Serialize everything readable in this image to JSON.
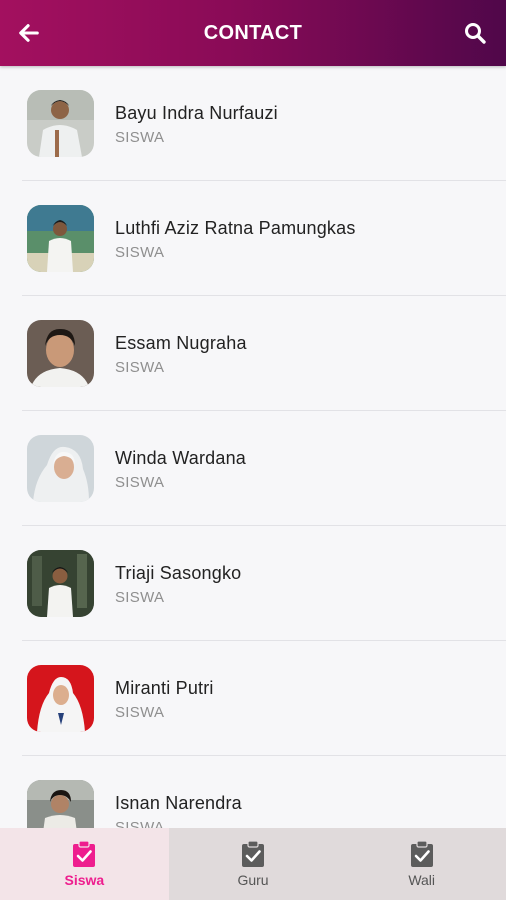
{
  "header": {
    "title": "CONTACT",
    "back_icon": "arrow-left-icon",
    "search_icon": "search-icon",
    "gradient_start": "#a3105f",
    "gradient_end": "#50074a"
  },
  "contacts": [
    {
      "name": "Bayu Indra Nurfauzi",
      "role": "SISWA",
      "avatar": "photo-avatar"
    },
    {
      "name": "Luthfi Aziz Ratna Pamungkas",
      "role": "SISWA",
      "avatar": "photo-avatar"
    },
    {
      "name": "Essam Nugraha",
      "role": "SISWA",
      "avatar": "photo-avatar"
    },
    {
      "name": "Winda Wardana",
      "role": "SISWA",
      "avatar": "photo-avatar"
    },
    {
      "name": "Triaji Sasongko",
      "role": "SISWA",
      "avatar": "photo-avatar"
    },
    {
      "name": "Miranti Putri",
      "role": "SISWA",
      "avatar": "photo-avatar"
    },
    {
      "name": "Isnan Narendra",
      "role": "SISWA",
      "avatar": "photo-avatar"
    }
  ],
  "bottom_nav": {
    "tabs": [
      {
        "label": "Siswa",
        "icon": "clipboard-check-icon",
        "active": true
      },
      {
        "label": "Guru",
        "icon": "clipboard-check-icon",
        "active": false
      },
      {
        "label": "Wali",
        "icon": "clipboard-check-icon",
        "active": false
      }
    ],
    "active_color": "#ee1e8e",
    "inactive_color": "#555555"
  }
}
